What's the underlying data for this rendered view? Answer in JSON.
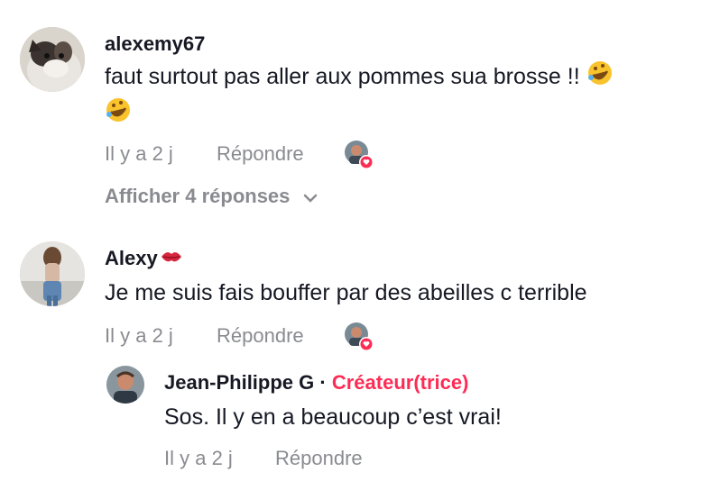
{
  "comments": [
    {
      "username": "alexemy67",
      "text": "faut surtout pas aller aux pommes sua brosse !!",
      "time": "Il y a 2 j",
      "reply_label": "Répondre",
      "show_replies": "Afficher 4 réponses",
      "creator_liked": true
    },
    {
      "username": "Alexy",
      "text": "Je me suis fais bouffer par des abeilles c terrible",
      "time": "Il y a 2 j",
      "reply_label": "Répondre",
      "creator_liked": true,
      "replies": [
        {
          "username": "Jean-Philippe G",
          "separator": "·",
          "badge": "Créateur(trice)",
          "text": "Sos. Il y en a beaucoup c’est vrai!",
          "time": "Il y a 2 j",
          "reply_label": "Répondre"
        }
      ]
    }
  ],
  "icons": {
    "laugh_emoji": "rolling-on-floor-laughing-emoji",
    "lips_emoji": "kiss-mark-emoji",
    "chevron": "chevron-down-icon",
    "liked_heart": "heart-icon"
  },
  "colors": {
    "accent": "#fe2c55",
    "meta_text": "#8a8b91",
    "primary_text": "#161823"
  }
}
